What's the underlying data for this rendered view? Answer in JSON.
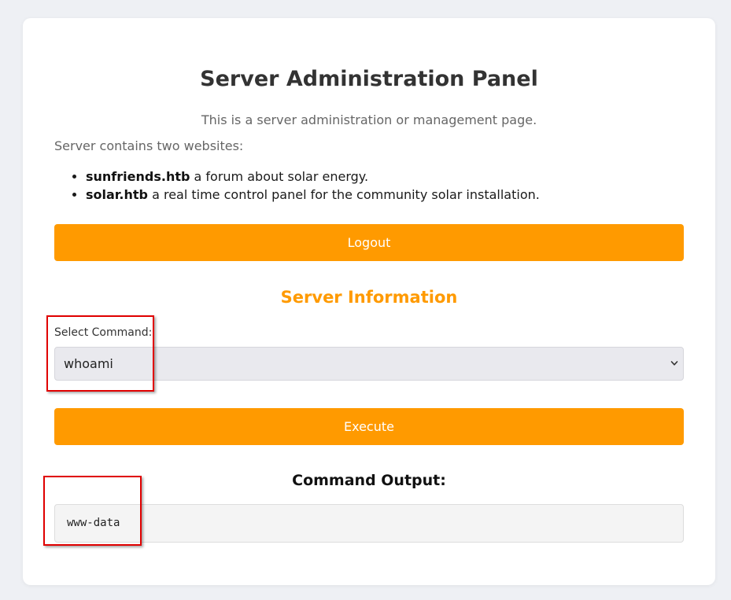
{
  "page": {
    "title": "Server Administration Panel",
    "subtitle": "This is a server administration or management page.",
    "intro": "Server contains two websites:",
    "sites": [
      {
        "name": "sunfriends.htb",
        "description": " a forum about solar energy."
      },
      {
        "name": "solar.htb",
        "description": " a real time control panel for the community solar installation."
      }
    ],
    "logout_label": "Logout"
  },
  "server_info": {
    "title": "Server Information",
    "select_label": "Select Command:",
    "selected_command": "whoami",
    "execute_label": "Execute"
  },
  "output": {
    "title": "Command Output:",
    "text": "www-data"
  },
  "colors": {
    "accent": "#ff9a00",
    "highlight": "#e00000",
    "background": "#eef0f4"
  },
  "icons": {
    "select_arrow": "chevron-down-icon"
  }
}
